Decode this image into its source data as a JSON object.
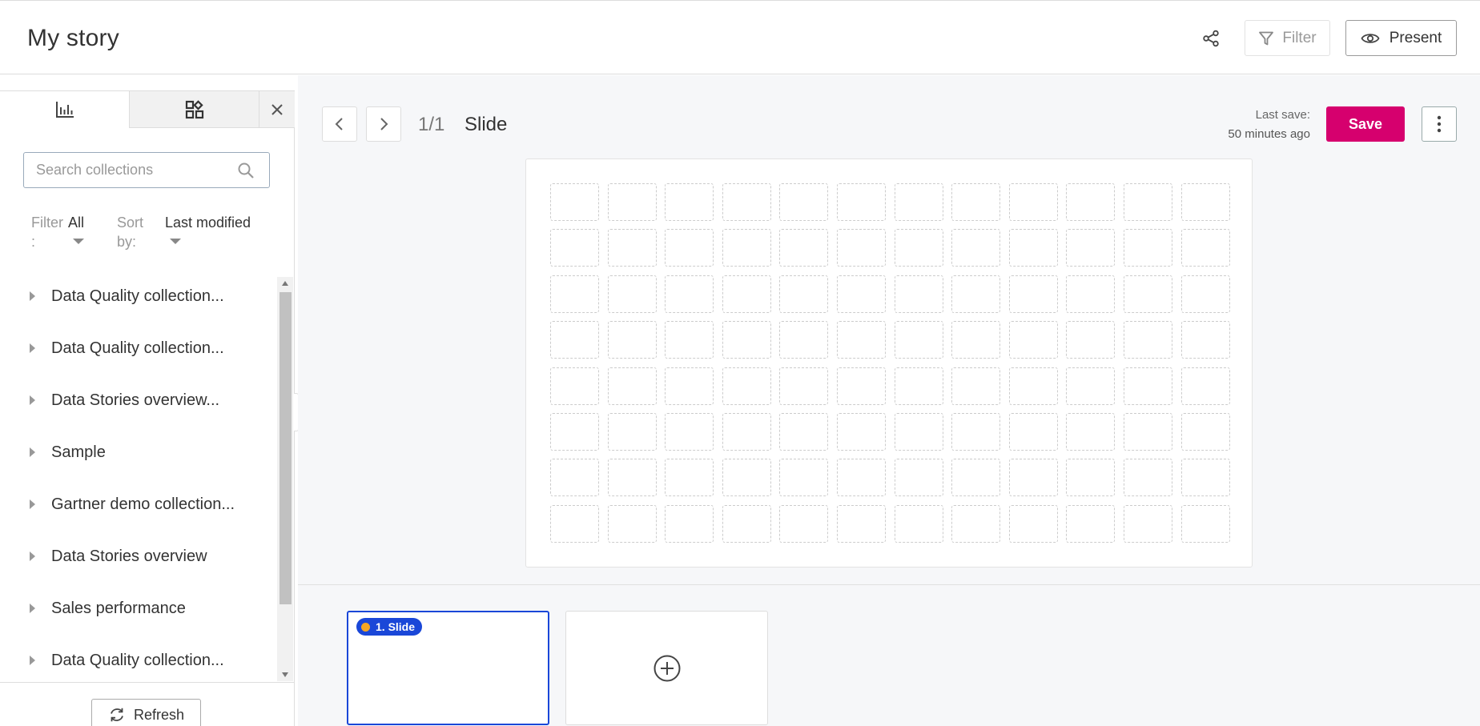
{
  "header": {
    "title": "My story",
    "filter_label": "Filter",
    "present_label": "Present"
  },
  "sidebar": {
    "search_placeholder": "Search collections",
    "filter_label": "Filter :",
    "filter_value": "All",
    "sort_label": "Sort by:",
    "sort_value": "Last modified",
    "items": [
      {
        "label": "Data Quality collection..."
      },
      {
        "label": "Data Quality collection..."
      },
      {
        "label": "Data Stories overview..."
      },
      {
        "label": "Sample"
      },
      {
        "label": "Gartner demo collection..."
      },
      {
        "label": "Data Stories overview"
      },
      {
        "label": "Sales performance"
      },
      {
        "label": "Data Quality collection..."
      }
    ],
    "refresh_label": "Refresh"
  },
  "main": {
    "page_indicator": "1/1",
    "slide_title": "Slide",
    "last_save_label": "Last save:",
    "last_save_time": "50 minutes ago",
    "save_label": "Save"
  },
  "thumbnails": [
    {
      "label": "1. Slide"
    }
  ],
  "colors": {
    "accent": "#d6006e",
    "selected": "#1a47d8",
    "badge_dot": "#f5a623"
  },
  "icons": {
    "share": "share-icon",
    "filter": "funnel-icon",
    "present": "eye-icon",
    "analyses_tab": "bar-chart-icon",
    "widgets_tab": "widgets-icon",
    "close": "close-icon",
    "search": "search-icon",
    "refresh": "refresh-icon",
    "prev": "chevron-left-icon",
    "next": "chevron-right-icon",
    "more": "kebab-icon",
    "add": "plus-circle-icon"
  }
}
